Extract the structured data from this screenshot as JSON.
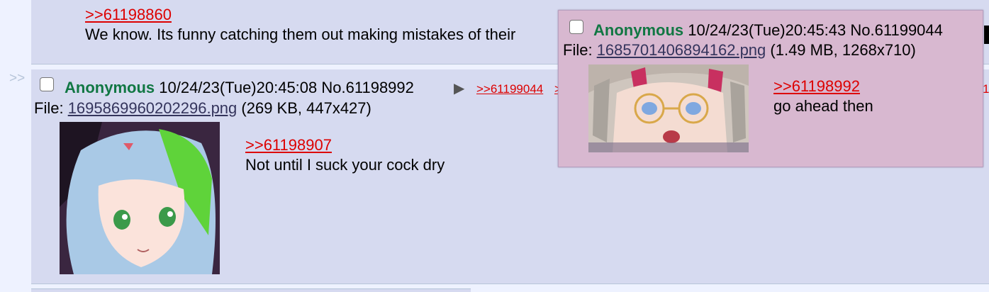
{
  "post_top": {
    "quote": ">>61198860",
    "text": "We know. Its funny catching them out making mistakes of their"
  },
  "side_arrows": ">>",
  "post_main": {
    "name": "Anonymous",
    "datetime": "10/24/23(Tue)20:45:08",
    "number": "No.61198992",
    "arrow": "▶",
    "backlink_1": ">>61199044",
    "backlink_2": ">",
    "file_prefix": "File: ",
    "file_name": "1695869960202296.png",
    "file_meta": " (269 KB, 447x427)",
    "quote": ">>61198907",
    "text": "Not until I suck your cock dry"
  },
  "preview_post": {
    "name": "Anonymous",
    "datetime": "10/24/23(Tue)20:45:43",
    "number": "No.61199044",
    "file_prefix": "File: ",
    "file_name": "1685701406894162.png",
    "file_meta": " (1.49 MB, 1268x710)",
    "quote": ">>61198992",
    "text": "go ahead then"
  },
  "right_fragment": "1",
  "colors": {
    "page_bg": "#eef2ff",
    "reply_bg": "#d6daf0",
    "preview_bg": "#d8b8d0",
    "name": "#117743",
    "quotelink": "#dd0000",
    "file_link": "#34345c"
  }
}
